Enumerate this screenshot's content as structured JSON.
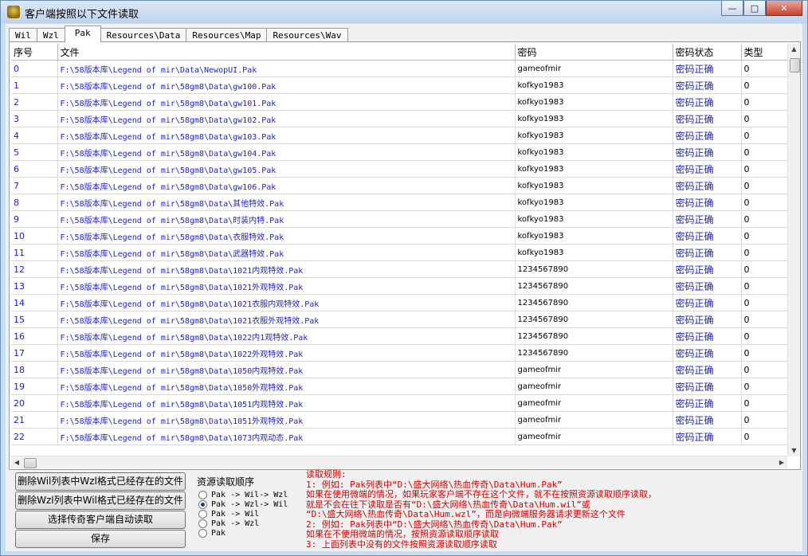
{
  "window": {
    "title": "客户端按照以下文件读取",
    "minimize_glyph": "—",
    "maximize_glyph": "□",
    "close_glyph": "✕"
  },
  "tabs": [
    {
      "label": "Wil",
      "active": false
    },
    {
      "label": "Wzl",
      "active": false
    },
    {
      "label": "Pak",
      "active": true
    },
    {
      "label": "Resources\\Data",
      "active": false
    },
    {
      "label": "Resources\\Map",
      "active": false
    },
    {
      "label": "Resources\\Wav",
      "active": false
    }
  ],
  "table": {
    "columns": [
      "序号",
      "文件",
      "密码",
      "密码状态",
      "类型"
    ],
    "rows": [
      [
        "0",
        "F:\\58版本库\\Legend of mir\\Data\\NewopUI.Pak",
        "gameofmir",
        "密码正确",
        "0"
      ],
      [
        "1",
        "F:\\58版本库\\Legend of mir\\58gm8\\Data\\gw100.Pak",
        "kofkyo1983",
        "密码正确",
        "0"
      ],
      [
        "2",
        "F:\\58版本库\\Legend of mir\\58gm8\\Data\\gw101.Pak",
        "kofkyo1983",
        "密码正确",
        "0"
      ],
      [
        "3",
        "F:\\58版本库\\Legend of mir\\58gm8\\Data\\gw102.Pak",
        "kofkyo1983",
        "密码正确",
        "0"
      ],
      [
        "4",
        "F:\\58版本库\\Legend of mir\\58gm8\\Data\\gw103.Pak",
        "kofkyo1983",
        "密码正确",
        "0"
      ],
      [
        "5",
        "F:\\58版本库\\Legend of mir\\58gm8\\Data\\gw104.Pak",
        "kofkyo1983",
        "密码正确",
        "0"
      ],
      [
        "6",
        "F:\\58版本库\\Legend of mir\\58gm8\\Data\\gw105.Pak",
        "kofkyo1983",
        "密码正确",
        "0"
      ],
      [
        "7",
        "F:\\58版本库\\Legend of mir\\58gm8\\Data\\gw106.Pak",
        "kofkyo1983",
        "密码正确",
        "0"
      ],
      [
        "8",
        "F:\\58版本库\\Legend of mir\\58gm8\\Data\\其他特效.Pak",
        "kofkyo1983",
        "密码正确",
        "0"
      ],
      [
        "9",
        "F:\\58版本库\\Legend of mir\\58gm8\\Data\\时装内特.Pak",
        "kofkyo1983",
        "密码正确",
        "0"
      ],
      [
        "10",
        "F:\\58版本库\\Legend of mir\\58gm8\\Data\\衣服特效.Pak",
        "kofkyo1983",
        "密码正确",
        "0"
      ],
      [
        "11",
        "F:\\58版本库\\Legend of mir\\58gm8\\Data\\武器特效.Pak",
        "kofkyo1983",
        "密码正确",
        "0"
      ],
      [
        "12",
        "F:\\58版本库\\Legend of mir\\58gm8\\Data\\1021内观特效.Pak",
        "1234567890",
        "密码正确",
        "0"
      ],
      [
        "13",
        "F:\\58版本库\\Legend of mir\\58gm8\\Data\\1021外观特效.Pak",
        "1234567890",
        "密码正确",
        "0"
      ],
      [
        "14",
        "F:\\58版本库\\Legend of mir\\58gm8\\Data\\1021衣服内观特效.Pak",
        "1234567890",
        "密码正确",
        "0"
      ],
      [
        "15",
        "F:\\58版本库\\Legend of mir\\58gm8\\Data\\1021衣服外观特效.Pak",
        "1234567890",
        "密码正确",
        "0"
      ],
      [
        "16",
        "F:\\58版本库\\Legend of mir\\58gm8\\Data\\1022内1观特效.Pak",
        "1234567890",
        "密码正确",
        "0"
      ],
      [
        "17",
        "F:\\58版本库\\Legend of mir\\58gm8\\Data\\1022外观特效.Pak",
        "1234567890",
        "密码正确",
        "0"
      ],
      [
        "18",
        "F:\\58版本库\\Legend of mir\\58gm8\\Data\\1050内观特效.Pak",
        "gameofmir",
        "密码正确",
        "0"
      ],
      [
        "19",
        "F:\\58版本库\\Legend of mir\\58gm8\\Data\\1050外观特效.Pak",
        "gameofmir",
        "密码正确",
        "0"
      ],
      [
        "20",
        "F:\\58版本库\\Legend of mir\\58gm8\\Data\\1051内观特效.Pak",
        "gameofmir",
        "密码正确",
        "0"
      ],
      [
        "21",
        "F:\\58版本库\\Legend of mir\\58gm8\\Data\\1051外观特效.Pak",
        "gameofmir",
        "密码正确",
        "0"
      ],
      [
        "22",
        "F:\\58版本库\\Legend of mir\\58gm8\\Data\\1073内观动态.Pak",
        "gameofmir",
        "密码正确",
        "0"
      ]
    ]
  },
  "buttons": {
    "delete_wil": "删除Wil列表中Wzl格式已经存在的文件",
    "delete_wzl": "删除Wzl列表中Wil格式已经存在的文件",
    "auto_read": "选择传奇客户端自动读取",
    "save": "保存"
  },
  "read_order": {
    "title": "资源读取顺序",
    "options": [
      {
        "label": "Pak -> Wil-> Wzl",
        "selected": false
      },
      {
        "label": "Pak -> Wzl-> Wil",
        "selected": true
      },
      {
        "label": "Pak -> Wil",
        "selected": false
      },
      {
        "label": "Pak -> Wzl",
        "selected": false
      },
      {
        "label": "Pak",
        "selected": false
      }
    ]
  },
  "rules": {
    "lines": [
      "读取规则:",
      "1: 例如: Pak列表中“D:\\盛大网络\\热血传奇\\Data\\Hum.Pak”",
      "    如果在使用微端的情况，如果玩家客户端不存在这个文件，就不在按照资源读取顺序读取，",
      "    就是不会在往下读取是否有“D:\\盛大网络\\热血传奇\\Data\\Hum.wil”或",
      "    “D:\\盛大网络\\热血传奇\\Data\\Hum.wzl”，而是向微端服务器请求更新这个文件",
      "2: 例如: Pak列表中“D:\\盛大网络\\热血传奇\\Data\\Hum.Pak”",
      "    如果在不使用微端的情况，按照资源读取顺序读取",
      "3: 上面列表中没有的文件按照资源读取顺序读取"
    ]
  },
  "colors": {
    "link_blue": "#1d1dc8",
    "rule_red": "#d40000",
    "titlebar": "#c9dcf1"
  }
}
